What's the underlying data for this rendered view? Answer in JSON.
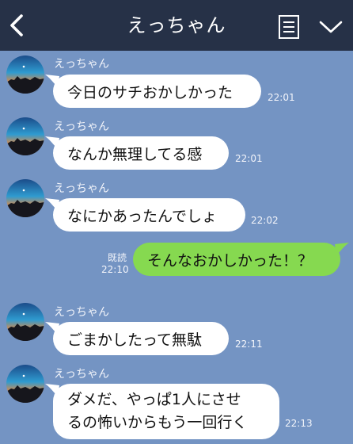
{
  "header": {
    "title": "えっちゃん",
    "back_icon": "chevron-left-icon",
    "menu_icon": "notes-icon",
    "more_icon": "chevron-down-icon",
    "background": "#263147"
  },
  "chat": {
    "background": "#7494c3",
    "incoming_color": "#ffffff",
    "outgoing_color": "#86d950",
    "messages": [
      {
        "sender": "えっちゃん",
        "text": "今日のサチおかしかった",
        "time": "22:01"
      },
      {
        "sender": "えっちゃん",
        "text": "なんか無理してる感",
        "time": "22:01"
      },
      {
        "sender": "えっちゃん",
        "text": "なにかあったんでしょ",
        "time": "22:02"
      },
      {
        "outgoing": true,
        "text": "そんなおかしかった！？",
        "read": "既読",
        "time": "22:10"
      },
      {
        "sender": "えっちゃん",
        "text": "ごまかしたって無駄",
        "time": "22:11"
      },
      {
        "sender": "えっちゃん",
        "text_lines": [
          "ダメだ、やっぱ1人にさせ",
          "るの怖いからもう一回行く"
        ],
        "time": "22:13"
      }
    ]
  }
}
